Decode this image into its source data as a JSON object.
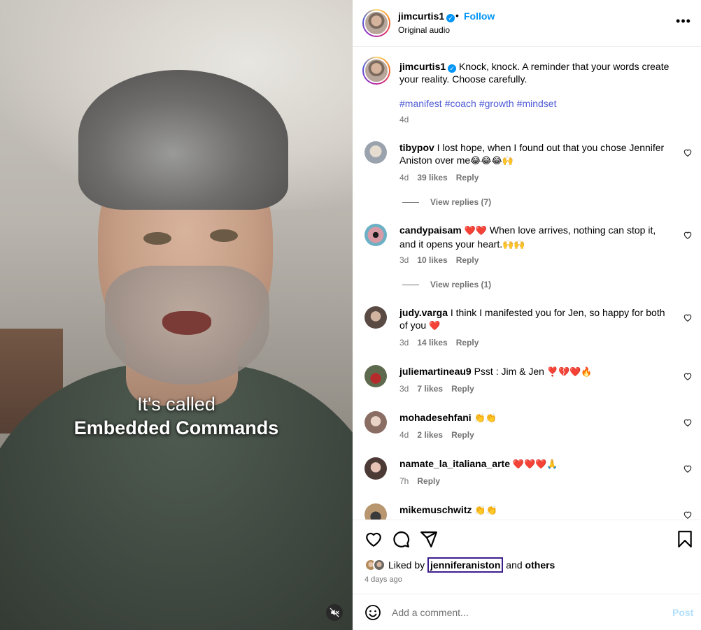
{
  "video": {
    "caption_line1": "It's called",
    "caption_line2": "Embedded Commands",
    "mute_icon": "speaker-muted-icon"
  },
  "header": {
    "username": "jimcurtis1",
    "separator": "•",
    "follow_label": "Follow",
    "audio": "Original audio",
    "more_icon": "more-horizontal-icon"
  },
  "caption": {
    "username": "jimcurtis1",
    "text": " Knock, knock. A reminder that your words create your reality. Choose carefully.",
    "hashtags": [
      "#manifest",
      "#coach",
      "#growth",
      "#mindset"
    ],
    "time": "4d"
  },
  "comments": [
    {
      "username": "tibypov",
      "text": " I lost hope, when I found out that you chose Jennifer Aniston over me",
      "emoji": "😂😂😂🙌",
      "time": "4d",
      "likes": "39 likes",
      "reply": "Reply",
      "view_replies": "View replies (7)"
    },
    {
      "username": "candypaisam",
      "text": " ",
      "emoji_lead": "❤️❤️",
      "text2": " When love arrives, nothing can stop it, and it opens your heart.",
      "emoji": "🙌🙌",
      "time": "3d",
      "likes": "10 likes",
      "reply": "Reply",
      "view_replies": "View replies (1)"
    },
    {
      "username": "judy.varga",
      "text": " I think I manifested you for Jen, so happy for both of you ",
      "emoji": "❤️",
      "time": "3d",
      "likes": "14 likes",
      "reply": "Reply"
    },
    {
      "username": "juliemartineau9",
      "text": " Psst : Jim & Jen ",
      "emoji": "❣️💔❤️🔥",
      "time": "3d",
      "likes": "7 likes",
      "reply": "Reply"
    },
    {
      "username": "mohadesehfani",
      "text": " ",
      "emoji": "👏👏",
      "time": "4d",
      "likes": "2 likes",
      "reply": "Reply"
    },
    {
      "username": "namate_la_italiana_arte",
      "text": " ",
      "emoji": "❤️❤️❤️🙏",
      "time": "7h",
      "reply": "Reply"
    },
    {
      "username": "mikemuschwitz",
      "text": " ",
      "emoji": "👏👏"
    }
  ],
  "actions": {
    "like_icon": "heart-outline-icon",
    "comment_icon": "comment-bubble-icon",
    "share_icon": "paper-plane-icon",
    "save_icon": "bookmark-icon",
    "liked_by_prefix": "Liked by",
    "liked_by_user": "jenniferaniston",
    "liked_by_and": "and",
    "liked_by_others": "others",
    "ago": "4 days ago"
  },
  "add_comment": {
    "placeholder": "Add a comment...",
    "post_label": "Post",
    "emoji_icon": "smiley-icon"
  },
  "colors": {
    "accent": "#0095f6",
    "hashtag": "#4f5bd5",
    "muted_text": "#737373",
    "highlight_box": "#3b1e8c",
    "post_disabled": "#b2dffc"
  }
}
